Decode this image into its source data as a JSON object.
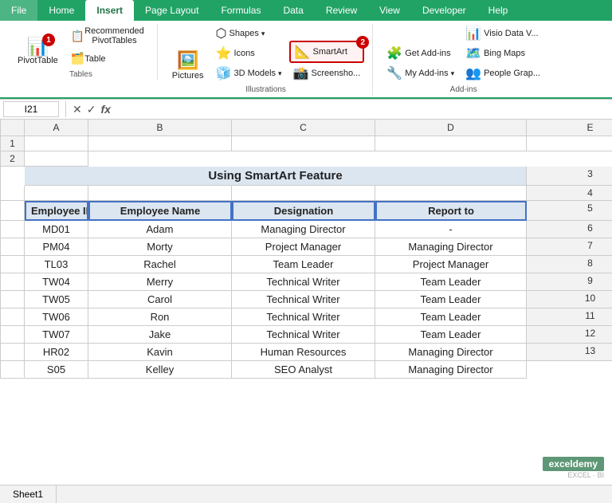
{
  "ribbon": {
    "tabs": [
      "File",
      "Home",
      "Insert",
      "Page Layout",
      "Formulas",
      "Data",
      "Review",
      "View",
      "Developer",
      "Help"
    ],
    "active_tab": "Insert",
    "tab_color": "#21a366",
    "groups": {
      "tables": {
        "label": "Tables",
        "items": [
          {
            "name": "PivotTable",
            "icon": "📊",
            "badge": "1"
          },
          {
            "name": "Recommended PivotTables",
            "icon": "📋"
          },
          {
            "name": "Table",
            "icon": "🗂️"
          }
        ]
      },
      "illustrations": {
        "label": "Illustrations",
        "items": [
          {
            "name": "Pictures",
            "icon": "🖼️"
          },
          {
            "name": "Shapes",
            "icon": "⬡"
          },
          {
            "name": "Icons",
            "icon": "⭐"
          },
          {
            "name": "3D Models",
            "icon": "🧊"
          },
          {
            "name": "SmartArt",
            "icon": "📐",
            "badge": "2",
            "highlighted": true
          },
          {
            "name": "Screenshot",
            "icon": "📸"
          }
        ]
      },
      "addins": {
        "label": "Add-ins",
        "items": [
          {
            "name": "Get Add-ins",
            "icon": "🧩"
          },
          {
            "name": "My Add-ins",
            "icon": "🔧"
          },
          {
            "name": "Visio Data V...",
            "icon": "📊"
          },
          {
            "name": "Bing Maps",
            "icon": "🗺️"
          },
          {
            "name": "People Grap...",
            "icon": "👥"
          }
        ]
      }
    }
  },
  "formula_bar": {
    "cell_ref": "I21",
    "formula": ""
  },
  "spreadsheet": {
    "title": "Using SmartArt Feature",
    "columns": [
      "",
      "A",
      "B",
      "C",
      "D",
      "E"
    ],
    "headers": [
      "Employee ID",
      "Employee Name",
      "Designation",
      "Report to"
    ],
    "rows": [
      {
        "num": "1",
        "cells": [
          "",
          "",
          "",
          "",
          ""
        ]
      },
      {
        "num": "2",
        "cells": [
          "",
          "Using SmartArt Feature",
          "",
          "",
          ""
        ]
      },
      {
        "num": "3",
        "cells": [
          "",
          "",
          "",
          "",
          ""
        ]
      },
      {
        "num": "4",
        "cells": [
          "Employee ID",
          "Employee Name",
          "Designation",
          "Report to"
        ]
      },
      {
        "num": "5",
        "cells": [
          "MD01",
          "Adam",
          "Managing Director",
          "-"
        ]
      },
      {
        "num": "6",
        "cells": [
          "PM04",
          "Morty",
          "Project Manager",
          "Managing Director"
        ]
      },
      {
        "num": "7",
        "cells": [
          "TL03",
          "Rachel",
          "Team Leader",
          "Project Manager"
        ]
      },
      {
        "num": "8",
        "cells": [
          "TW04",
          "Merry",
          "Technical Writer",
          "Team Leader"
        ]
      },
      {
        "num": "9",
        "cells": [
          "TW05",
          "Carol",
          "Technical Writer",
          "Team Leader"
        ]
      },
      {
        "num": "10",
        "cells": [
          "TW06",
          "Ron",
          "Technical Writer",
          "Team Leader"
        ]
      },
      {
        "num": "11",
        "cells": [
          "TW07",
          "Jake",
          "Technical Writer",
          "Team Leader"
        ]
      },
      {
        "num": "12",
        "cells": [
          "HR02",
          "Kavin",
          "Human Resources",
          "Managing Director"
        ]
      },
      {
        "num": "13",
        "cells": [
          "S05",
          "Kelley",
          "SEO Analyst",
          "Managing Director"
        ]
      }
    ]
  }
}
